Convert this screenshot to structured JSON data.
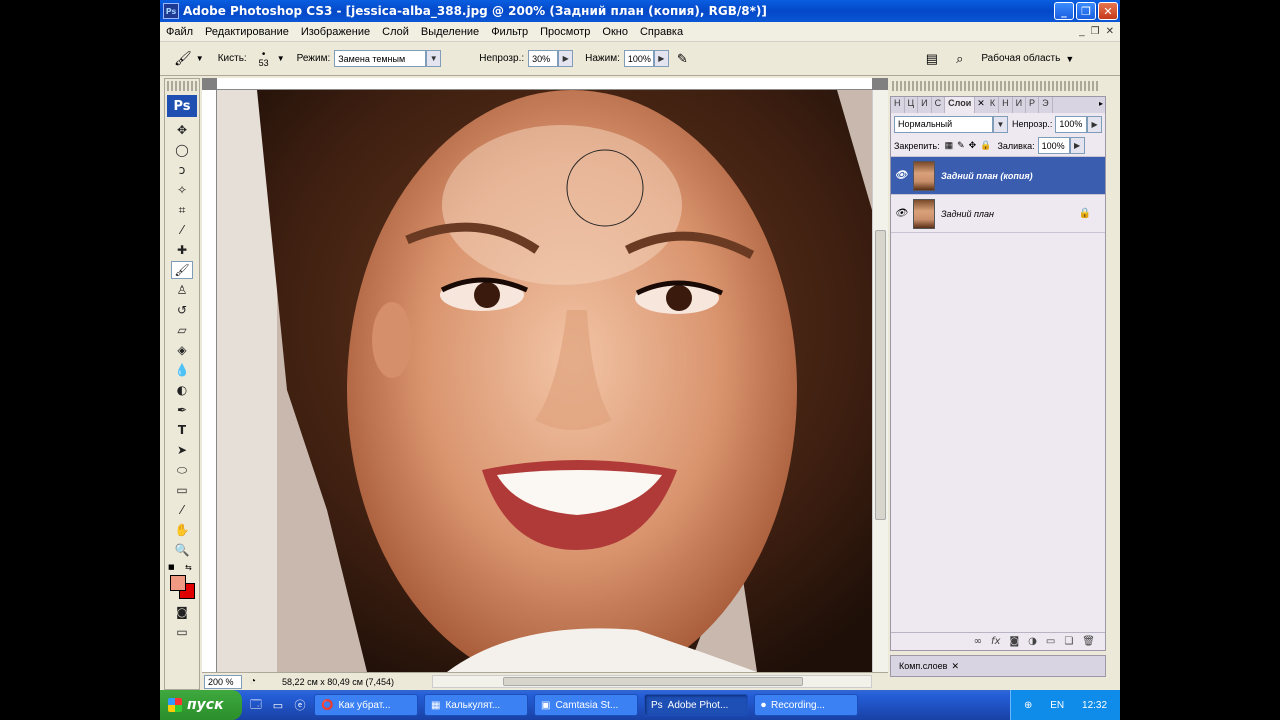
{
  "window": {
    "title": "Adobe Photoshop CS3 - [jessica-alba_388.jpg @ 200% (Задний план (копия), RGB/8*)]",
    "app_icon": "Ps"
  },
  "menu": [
    "Файл",
    "Редактирование",
    "Изображение",
    "Слой",
    "Выделение",
    "Фильтр",
    "Просмотр",
    "Окно",
    "Справка"
  ],
  "options": {
    "brush_label": "Кисть:",
    "brush_size": "53",
    "mode_label": "Режим:",
    "mode_value": "Замена темным",
    "opacity_label": "Непрозр.:",
    "opacity_value": "30%",
    "flow_label": "Нажим:",
    "flow_value": "100%",
    "workspace": "Рабочая область"
  },
  "toolbox": {
    "logo": "Ps"
  },
  "document": {
    "zoom": "200 %",
    "info": "58,22 см x 80,49 см (7,454)"
  },
  "layers_panel": {
    "tabs": [
      "Н",
      "Ц",
      "И",
      "С",
      "Слои",
      "К",
      "Н",
      "И",
      "Р",
      "Э"
    ],
    "active_tab": "Слои",
    "blend_mode": "Нормальный",
    "opacity_label": "Непрозр.:",
    "opacity_value": "100%",
    "lock_label": "Закрепить:",
    "fill_label": "Заливка:",
    "fill_value": "100%",
    "layers": [
      {
        "name": "Задний план (копия)",
        "selected": true
      },
      {
        "name": "Задний план",
        "selected": false,
        "locked": true
      }
    ]
  },
  "comps_panel": {
    "label": "Комп.слоев"
  },
  "taskbar": {
    "start": "пуск",
    "tasks": [
      "Как убрат...",
      "Калькулят...",
      "Camtasia St...",
      "Adobe Phot...",
      "Recording..."
    ],
    "active_task": "Adobe Phot...",
    "lang": "EN",
    "clock": "12:32"
  }
}
